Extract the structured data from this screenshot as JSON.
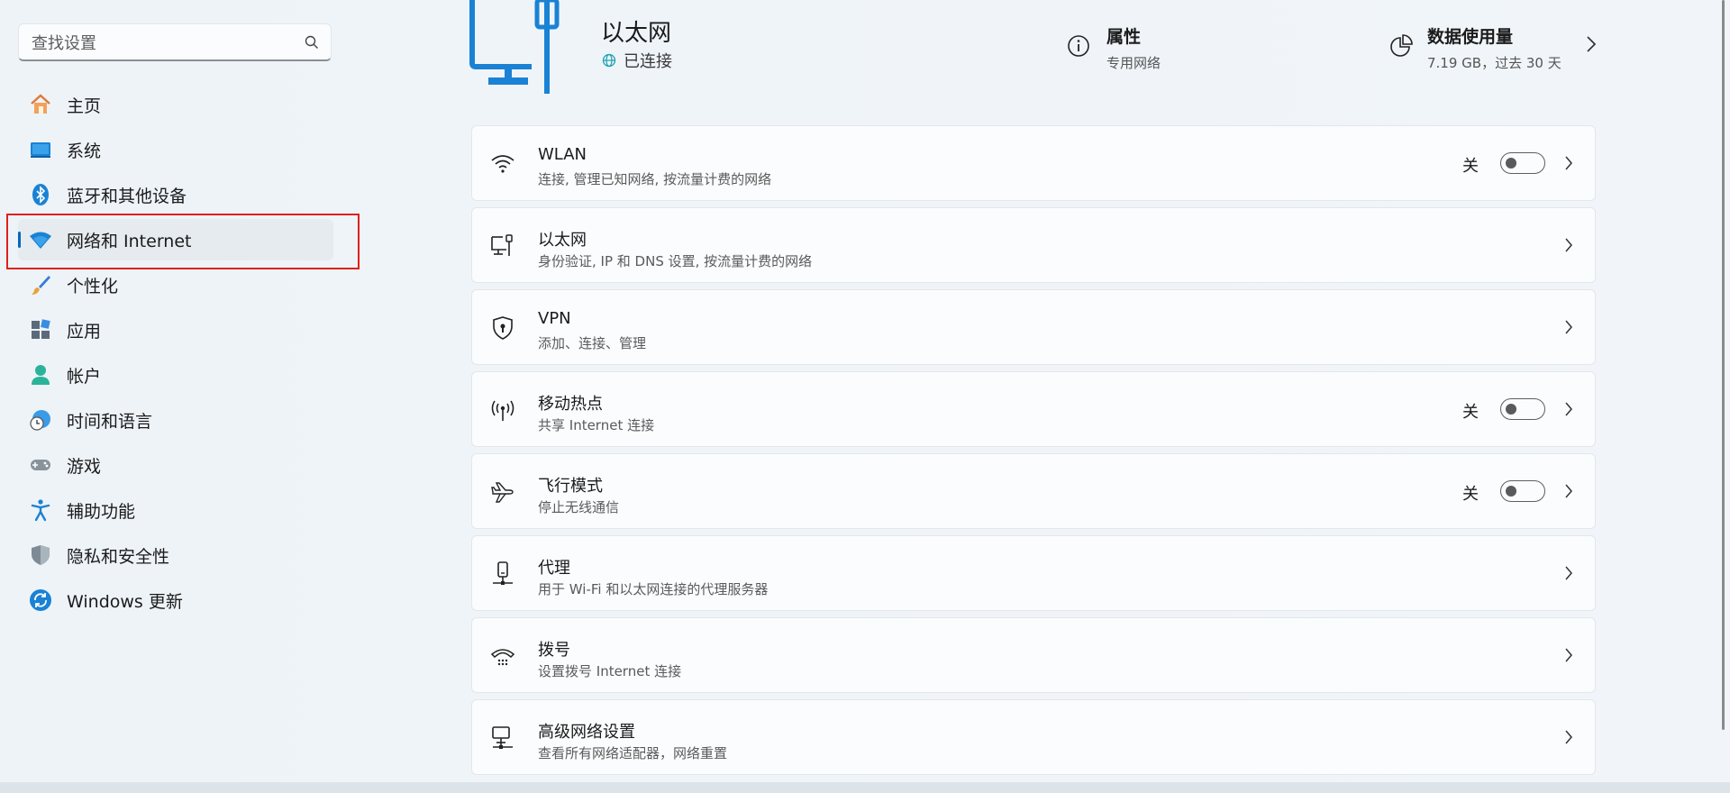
{
  "search": {
    "placeholder": "查找设置"
  },
  "sidebar": {
    "items": [
      {
        "label": "主页",
        "icon": "home-icon",
        "active": false
      },
      {
        "label": "系统",
        "icon": "system-icon",
        "active": false
      },
      {
        "label": "蓝牙和其他设备",
        "icon": "bluetooth-icon",
        "active": false
      },
      {
        "label": "网络和 Internet",
        "icon": "wifi-icon",
        "active": true
      },
      {
        "label": "个性化",
        "icon": "brush-icon",
        "active": false
      },
      {
        "label": "应用",
        "icon": "apps-icon",
        "active": false
      },
      {
        "label": "帐户",
        "icon": "account-icon",
        "active": false
      },
      {
        "label": "时间和语言",
        "icon": "clock-globe-icon",
        "active": false
      },
      {
        "label": "游戏",
        "icon": "gamepad-icon",
        "active": false
      },
      {
        "label": "辅助功能",
        "icon": "accessibility-icon",
        "active": false
      },
      {
        "label": "隐私和安全性",
        "icon": "shield-icon",
        "active": false
      },
      {
        "label": "Windows 更新",
        "icon": "update-icon",
        "active": false
      }
    ]
  },
  "header": {
    "title": "以太网",
    "status": "已连接",
    "properties": {
      "title": "属性",
      "subtitle": "专用网络"
    },
    "usage": {
      "title": "数据使用量",
      "subtitle": "7.19 GB，过去 30 天"
    }
  },
  "cards": [
    {
      "title": "WLAN",
      "subtitle": "连接, 管理已知网络, 按流量计费的网络",
      "icon": "wlan-icon",
      "toggle": "关"
    },
    {
      "title": "以太网",
      "subtitle": "身份验证, IP 和 DNS 设置, 按流量计费的网络",
      "icon": "ethernet-icon"
    },
    {
      "title": "VPN",
      "subtitle": "添加、连接、管理",
      "icon": "vpn-shield-icon"
    },
    {
      "title": "移动热点",
      "subtitle": "共享 Internet 连接",
      "icon": "hotspot-icon",
      "toggle": "关"
    },
    {
      "title": "飞行模式",
      "subtitle": "停止无线通信",
      "icon": "airplane-icon",
      "toggle": "关"
    },
    {
      "title": "代理",
      "subtitle": "用于 Wi-Fi 和以太网连接的代理服务器",
      "icon": "proxy-icon"
    },
    {
      "title": "拨号",
      "subtitle": "设置拨号 Internet 连接",
      "icon": "dialup-icon"
    },
    {
      "title": "高级网络设置",
      "subtitle": "查看所有网络适配器，网络重置",
      "icon": "advanced-network-icon"
    }
  ],
  "colors": {
    "accent": "#0067c0",
    "highlight": "#e0201a"
  }
}
